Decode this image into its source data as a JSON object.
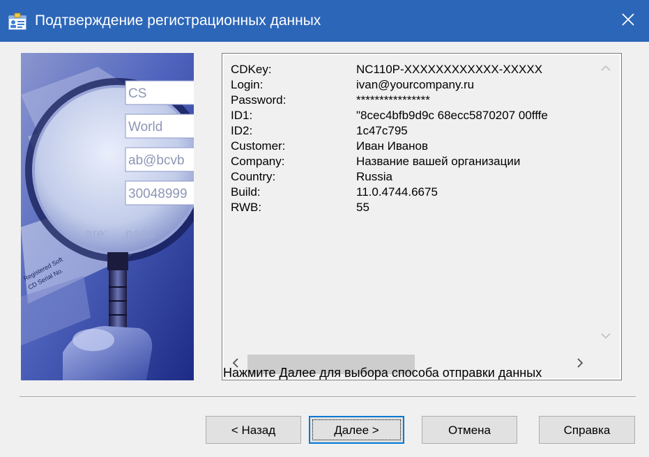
{
  "window": {
    "title": "Подтверждение регистрационных данных",
    "title_icon": "registration-card-icon",
    "close_icon": "close-icon",
    "titlebar_color": "#2c66b8"
  },
  "picture": {
    "description_icon": "magnifier-registration-illustration-icon",
    "form_fields": [
      "CS",
      "World",
      "ab@bcvb",
      "30048999"
    ],
    "form_label": "are:",
    "form_value": "nano",
    "paper_lines": [
      "Registered Soft",
      "CD Serial No."
    ]
  },
  "info": {
    "rows": [
      {
        "label": "CDKey:",
        "value": "NC110P-XXXXXXXXXXXX-XXXXX"
      },
      {
        "label": "Login:",
        "value": "ivan@yourcompany.ru"
      },
      {
        "label": "Password:",
        "value": "****************"
      },
      {
        "label": "ID1:",
        "value": "\"8cec4bfb9d9c 68ecc5870207 00fffe"
      },
      {
        "label": "ID2:",
        "value": "1c47c795"
      },
      {
        "label": "Customer:",
        "value": "Иван Иванов"
      },
      {
        "label": "Company:",
        "value": "Название вашей организации"
      },
      {
        "label": "Country:",
        "value": "Russia"
      },
      {
        "label": "Build:",
        "value": "11.0.4744.6675"
      },
      {
        "label": "RWB:",
        "value": "55"
      }
    ]
  },
  "hint": "Нажмите Далее для выбора способа отправки данных",
  "buttons": {
    "back": "< Назад",
    "next": "Далее >",
    "cancel": "Отмена",
    "help": "Справка"
  }
}
